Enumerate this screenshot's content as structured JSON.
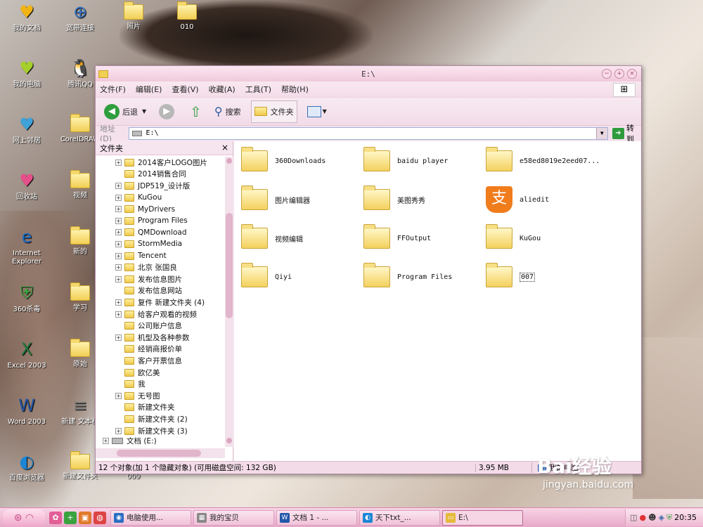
{
  "desktop": {
    "icons": [
      {
        "label": "我的文档",
        "glyph": "♥",
        "color": "#f2b316"
      },
      {
        "label": "宽带连接",
        "glyph": "⊕",
        "color": "#3a78c7"
      },
      {
        "label": "照片",
        "glyph": "",
        "color": "#f2cf55"
      },
      {
        "label": "010",
        "glyph": "",
        "color": "#f2cf55"
      },
      {
        "label": "我的电脑",
        "glyph": "♥",
        "color": "#a6cf2b"
      },
      {
        "label": "腾讯QQ",
        "glyph": "🐧",
        "color": "#222"
      },
      {
        "label": "网上邻居",
        "glyph": "♥",
        "color": "#3fa2d9"
      },
      {
        "label": "CorelDRAW",
        "glyph": "",
        "color": "#f2cf55"
      },
      {
        "label": "回收站",
        "glyph": "♥",
        "color": "#e6508a"
      },
      {
        "label": "视频",
        "glyph": "",
        "color": "#f2cf55"
      },
      {
        "label": "Internet Explorer",
        "glyph": "e",
        "color": "#1a6dc9"
      },
      {
        "label": "新的",
        "glyph": "",
        "color": "#f2cf55"
      },
      {
        "label": "360杀毒",
        "glyph": "⛨",
        "color": "#3aa33f"
      },
      {
        "label": "学习",
        "glyph": "",
        "color": "#f2cf55"
      },
      {
        "label": "Excel 2003",
        "glyph": "X",
        "color": "#1e7a3c"
      },
      {
        "label": "原始",
        "glyph": "",
        "color": "#f2cf55"
      },
      {
        "label": "Word 2003",
        "glyph": "W",
        "color": "#2457a8"
      },
      {
        "label": "新建 文本档",
        "glyph": "≡",
        "color": "#777"
      },
      {
        "label": "百度浏览器",
        "glyph": "◐",
        "color": "#1b86d6"
      },
      {
        "label": "新建文件夹",
        "glyph": "",
        "color": "#f2cf55"
      },
      {
        "label": "009",
        "glyph": "",
        "color": "#f2cf55"
      }
    ]
  },
  "window": {
    "title": "E:\\",
    "menu": [
      "文件(F)",
      "编辑(E)",
      "查看(V)",
      "收藏(A)",
      "工具(T)",
      "帮助(H)"
    ],
    "toolbar": {
      "back": "后退",
      "search": "搜索",
      "folders": "文件夹"
    },
    "address": {
      "label": "地址(D)",
      "value": "E:\\",
      "go": "转到"
    },
    "left_pane": {
      "title": "文件夹",
      "tree": [
        {
          "label": "2014客户LOGO图片",
          "expandable": true
        },
        {
          "label": "2014销售合同",
          "expandable": false
        },
        {
          "label": "JDP519_设计版",
          "expandable": true
        },
        {
          "label": "KuGou",
          "expandable": true
        },
        {
          "label": "MyDrivers",
          "expandable": true
        },
        {
          "label": "Program Files",
          "expandable": true
        },
        {
          "label": "QMDownload",
          "expandable": true
        },
        {
          "label": "StormMedia",
          "expandable": true
        },
        {
          "label": "Tencent",
          "expandable": true
        },
        {
          "label": "北京 张国良",
          "expandable": true
        },
        {
          "label": "发布信息图片",
          "expandable": true
        },
        {
          "label": "发布信息网站",
          "expandable": false
        },
        {
          "label": "复件 新建文件夹 (4)",
          "expandable": true
        },
        {
          "label": "给客户观看的视频",
          "expandable": true
        },
        {
          "label": "公司账户信息",
          "expandable": false
        },
        {
          "label": "机型及各种参数",
          "expandable": true
        },
        {
          "label": "经销商报价单",
          "expandable": false
        },
        {
          "label": "客户开票信息",
          "expandable": false
        },
        {
          "label": "欧亿美",
          "expandable": false
        },
        {
          "label": "我",
          "expandable": false
        },
        {
          "label": "无号图",
          "expandable": true
        },
        {
          "label": "新建文件夹",
          "expandable": false
        },
        {
          "label": "新建文件夹 (2)",
          "expandable": false
        },
        {
          "label": "新建文件夹 (3)",
          "expandable": true
        }
      ],
      "drive_label": "文档 (E:)"
    },
    "items": [
      {
        "name": "360Downloads",
        "type": "folder"
      },
      {
        "name": "baidu player",
        "type": "folder"
      },
      {
        "name": "e58ed8019e2eed07...",
        "type": "folder"
      },
      {
        "name": "图片编辑器",
        "type": "folder"
      },
      {
        "name": "美图秀秀",
        "type": "folder"
      },
      {
        "name": "aliedit",
        "type": "alipay"
      },
      {
        "name": "视频编辑",
        "type": "folder"
      },
      {
        "name": "FFOutput",
        "type": "folder"
      },
      {
        "name": "KuGou",
        "type": "folder"
      },
      {
        "name": "Qiyi",
        "type": "folder"
      },
      {
        "name": "Program Files",
        "type": "folder"
      },
      {
        "name": "007",
        "type": "folder",
        "selected": true
      }
    ],
    "status": {
      "objects": "12 个对象(加 1 个隐藏对象) (可用磁盘空间: 132 GB)",
      "size": "3.95 MB",
      "location": "我的电脑"
    }
  },
  "taskbar": {
    "tasks": [
      {
        "label": "电脑使用...",
        "color": "#2b6fc4",
        "icon": "◉"
      },
      {
        "label": "我的宝贝",
        "color": "#888",
        "icon": "▦"
      },
      {
        "label": "文档 1 - ...",
        "color": "#2457a8",
        "icon": "W"
      },
      {
        "label": "天下txt_...",
        "color": "#1b86d6",
        "icon": "◐"
      },
      {
        "label": "E:\\",
        "color": "#e5b93a",
        "icon": "▭"
      }
    ],
    "clock": "20:35"
  },
  "watermark": {
    "brand": "Bai经验",
    "url": "jingyan.baidu.com"
  }
}
